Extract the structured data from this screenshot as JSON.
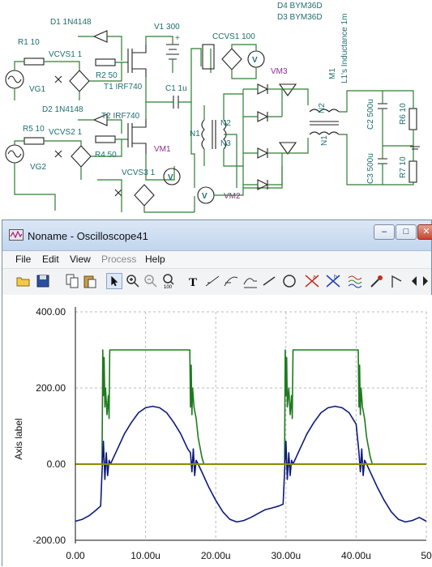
{
  "schematic": {
    "labels": {
      "d1": "D1 1N4148",
      "d2": "D2 1N4148",
      "r1": "R1 10",
      "r2": "R2 50",
      "r4": "R4 50",
      "r5": "R5 10",
      "r6": "R6 10",
      "r7": "R7 10",
      "vcvs1": "VCVS1 1",
      "vcvs2": "VCVS2 1",
      "vcvs3": "VCVS3 1",
      "vg1": "VG1",
      "vg2": "VG2",
      "t1": "T1 IRF740",
      "t2": "T2 IRF740",
      "v1": "V1 300",
      "c1": "C1 1u",
      "c2": "C2 500u",
      "c3": "C3 500u",
      "ccvs1": "CCVS1 100",
      "vm1": "VM1",
      "vm2": "VM2",
      "vm3": "VM3",
      "d3": "D3 BYM36D",
      "d4": "D4 BYM36D",
      "m1": "M1",
      "l1": "L1's Inductance 1m",
      "n1a": "N1",
      "n2a": "N2",
      "n3": "N3",
      "n1b": "N1",
      "n2b": "N2",
      "v_letter": "V"
    }
  },
  "window": {
    "title": "Noname - Oscilloscope41",
    "buttons": {
      "minimize": "–",
      "maximize": "□",
      "close": "✕"
    }
  },
  "menu": [
    "File",
    "Edit",
    "View",
    "Process",
    "Help"
  ],
  "menu_disabled": [
    "Process"
  ],
  "toolbar": {
    "icons": [
      "open-icon",
      "save-icon",
      "copy-icon",
      "paste-icon",
      "pointer-icon",
      "zoom-in-icon",
      "zoom-out-icon",
      "zoom-100-icon",
      "text-icon",
      "line-annot-icon",
      "curve-annot-icon",
      "graph-icon",
      "diagonal-line-icon",
      "circle-icon",
      "cursor-a-icon",
      "cursor-b-icon",
      "waves-icon",
      "probe-icon",
      "flag-icon",
      "scroll-left-icon",
      "scroll-right-icon"
    ]
  },
  "colors": {
    "green_trace": "#1f7a1f",
    "blue_trace": "#0d1a7a",
    "olive_trace": "#8a8a00",
    "grid": "#bbbbbb",
    "axis_text": "#111111"
  },
  "chart_data": {
    "type": "line",
    "ylabel": "Axis label",
    "xlim": [
      0,
      50
    ],
    "ylim": [
      -200,
      400
    ],
    "x_ticks": [
      "0.00",
      "10.00u",
      "20.00u",
      "30.00u",
      "40.00u",
      "50"
    ],
    "x_tick_values": [
      0,
      10,
      20,
      30,
      40,
      50
    ],
    "y_ticks": [
      "-200.00",
      "0.00",
      "200.00",
      "400.00"
    ],
    "y_tick_values": [
      -200,
      0,
      200,
      400
    ],
    "grid": true,
    "series": [
      {
        "color": "green",
        "x": [
          0,
          3.8,
          3.9,
          4.0,
          4.1,
          4.2,
          4.3,
          4.5,
          4.7,
          4.8,
          4.9,
          5.0,
          5.2,
          16.3,
          16.4,
          16.5,
          16.6,
          16.7,
          16.9,
          17.0,
          17.2,
          17.5,
          18.0,
          18.3,
          50
        ],
        "y": [
          0,
          0,
          300,
          180,
          280,
          150,
          200,
          130,
          180,
          120,
          300,
          300,
          300,
          300,
          150,
          260,
          130,
          200,
          150,
          140,
          120,
          70,
          20,
          0,
          0
        ]
      },
      {
        "color": "green",
        "x": [
          29.8,
          29.9,
          30.0,
          30.1,
          30.2,
          30.4,
          30.6,
          30.8,
          30.9,
          31.0,
          31.2,
          40.3,
          40.4,
          40.5,
          40.6,
          40.7,
          40.9,
          41.0,
          41.2,
          41.5,
          42.0,
          42.3
        ],
        "y": [
          0,
          300,
          180,
          280,
          150,
          200,
          130,
          180,
          120,
          300,
          300,
          300,
          150,
          260,
          130,
          200,
          150,
          140,
          120,
          70,
          20,
          0
        ]
      },
      {
        "color": "blue",
        "x": [
          0,
          1,
          2,
          3,
          3.6,
          3.8,
          4.0,
          4.2,
          4.4,
          4.6,
          4.8,
          5.0,
          5.5,
          6,
          7,
          8,
          9,
          10,
          11,
          12,
          13,
          14,
          15,
          16,
          16.4,
          16.6,
          16.8,
          17.0,
          17.2,
          17.5,
          18,
          19,
          20,
          21,
          22,
          23,
          24,
          25,
          26,
          27,
          28,
          29,
          29.6,
          29.8,
          30.0,
          30.2,
          30.4,
          30.6,
          30.8,
          31.0,
          31.5,
          32,
          33,
          34,
          35,
          36,
          37,
          38,
          39,
          40,
          40.4,
          40.6,
          40.8,
          41.0,
          41.2,
          41.5,
          42,
          43,
          44,
          45,
          46,
          47,
          48,
          49,
          50
        ],
        "y": [
          -150,
          -145,
          -135,
          -120,
          -110,
          -20,
          60,
          -40,
          30,
          -30,
          10,
          0,
          20,
          40,
          80,
          110,
          135,
          148,
          152,
          148,
          135,
          110,
          80,
          40,
          30,
          -20,
          40,
          -30,
          10,
          0,
          -20,
          -60,
          -95,
          -125,
          -145,
          -152,
          -148,
          -140,
          -130,
          -120,
          -115,
          -110,
          -105,
          -20,
          60,
          -40,
          30,
          -30,
          10,
          0,
          20,
          40,
          80,
          110,
          135,
          148,
          152,
          148,
          135,
          105,
          30,
          -20,
          40,
          -30,
          10,
          0,
          -20,
          -60,
          -95,
          -125,
          -145,
          -152,
          -148,
          -140,
          -150
        ]
      },
      {
        "color": "olive",
        "x": [
          0,
          50
        ],
        "y": [
          0,
          0
        ]
      }
    ]
  }
}
